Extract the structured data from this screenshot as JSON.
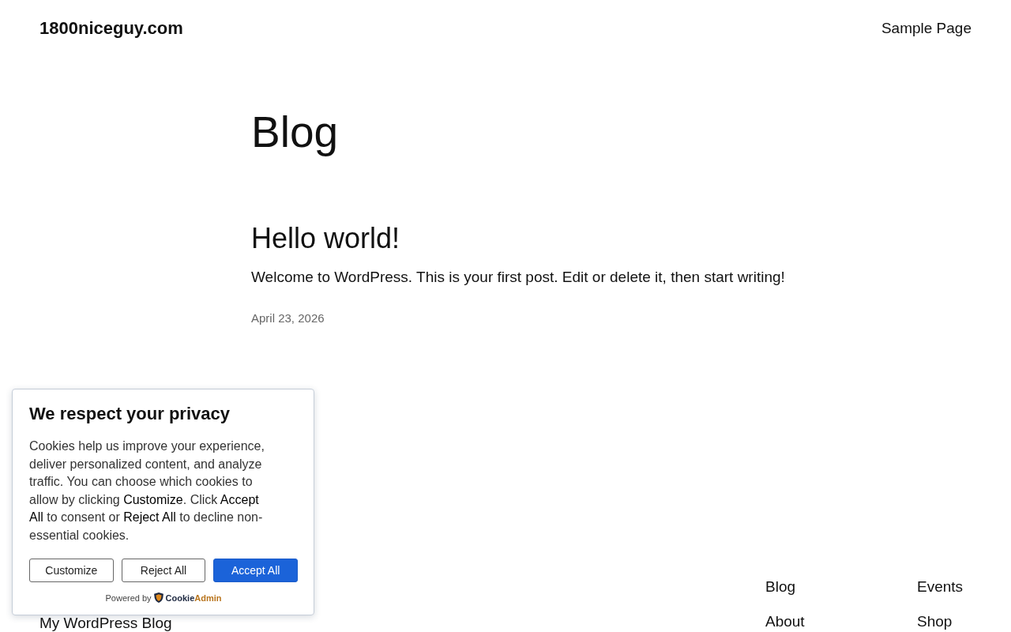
{
  "header": {
    "site_title": "1800niceguy.com",
    "nav": [
      "Sample Page"
    ]
  },
  "main": {
    "page_title": "Blog",
    "posts": [
      {
        "title": "Hello world!",
        "excerpt": "Welcome to WordPress. This is your first post. Edit or delete it, then start writing!",
        "date": "April 23, 2026"
      }
    ]
  },
  "footer": {
    "site_name": "My WordPress Blog",
    "nav_columns": [
      [
        "Blog",
        "About"
      ],
      [
        "Events",
        "Shop"
      ]
    ]
  },
  "cookie_banner": {
    "title": "We respect your privacy",
    "text": "Cookies help us improve your experience, deliver personalized content, and analyze traffic. You can choose which cookies to allow by clicking **Customize**. Click **Accept All** to consent or **Reject All** to decline non-essential cookies.",
    "buttons": [
      {
        "label": "Customize",
        "kind": "outline"
      },
      {
        "label": "Reject All",
        "kind": "outline"
      },
      {
        "label": "Accept All",
        "kind": "primary"
      }
    ],
    "powered_by": "Powered by",
    "brand": [
      "Cookie",
      "Admin"
    ]
  }
}
